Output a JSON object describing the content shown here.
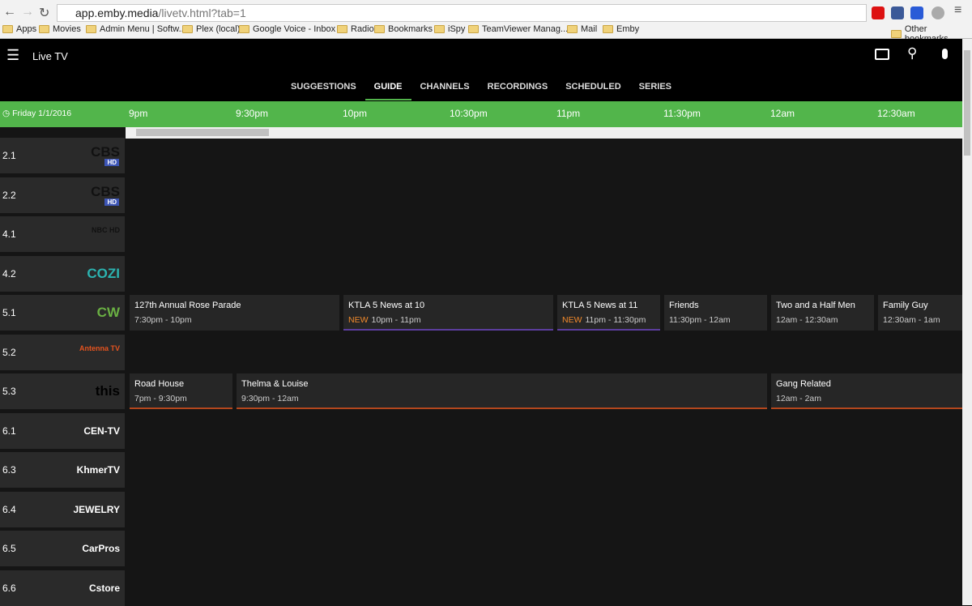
{
  "browser": {
    "url_host": "app.emby.media",
    "url_path": "/livetv.html?tab=1",
    "bookmarks": [
      "Apps",
      "Movies",
      "Admin Menu | Softw...",
      "Plex (local)",
      "Google Voice - Inbox",
      "Radio",
      "Bookmarks",
      "iSpy",
      "TeamViewer Manag...",
      "Mail",
      "Emby"
    ],
    "other_bookmarks": "Other bookmarks"
  },
  "app": {
    "title": "Live TV",
    "tabs": [
      "SUGGESTIONS",
      "GUIDE",
      "CHANNELS",
      "RECORDINGS",
      "SCHEDULED",
      "SERIES"
    ],
    "active_tab": "GUIDE",
    "accent": "#52b54b"
  },
  "guide": {
    "date": "Friday 1/1/2016",
    "times": [
      "9pm",
      "9:30pm",
      "10pm",
      "10:30pm",
      "11pm",
      "11:30pm",
      "12am",
      "12:30am"
    ],
    "channels": [
      {
        "number": "2.1",
        "logo": "CBS",
        "logo_sub": "HD"
      },
      {
        "number": "2.2",
        "logo": "CBS",
        "logo_sub": "HD"
      },
      {
        "number": "4.1",
        "logo": "NBC HD"
      },
      {
        "number": "4.2",
        "logo": "COZI"
      },
      {
        "number": "5.1",
        "logo": "CW"
      },
      {
        "number": "5.2",
        "logo": "Antenna TV"
      },
      {
        "number": "5.3",
        "logo": "this"
      },
      {
        "number": "6.1",
        "name": "CEN-TV"
      },
      {
        "number": "6.3",
        "name": "KhmerTV"
      },
      {
        "number": "6.4",
        "name": "JEWELRY"
      },
      {
        "number": "6.5",
        "name": "CarPros"
      },
      {
        "number": "6.6",
        "name": "Cstore"
      }
    ],
    "programs": [
      {
        "row": 4,
        "title": "127th Annual Rose Parade",
        "time": "7:30pm - 10pm",
        "start": -90,
        "end": 60
      },
      {
        "row": 4,
        "title": "KTLA 5 News at 10",
        "time": "10pm - 11pm",
        "new": "NEW",
        "start": 60,
        "end": 120,
        "border": "#5c3d9e"
      },
      {
        "row": 4,
        "title": "KTLA 5 News at 11",
        "time": "11pm - 11:30pm",
        "new": "NEW",
        "start": 120,
        "end": 150,
        "border": "#5c3d9e"
      },
      {
        "row": 4,
        "title": "Friends",
        "time": "11:30pm - 12am",
        "start": 150,
        "end": 180
      },
      {
        "row": 4,
        "title": "Two and a Half Men",
        "time": "12am - 12:30am",
        "start": 180,
        "end": 210
      },
      {
        "row": 4,
        "title": "Family Guy",
        "time": "12:30am - 1am",
        "start": 210,
        "end": 240
      },
      {
        "row": 6,
        "title": "Road House",
        "time": "7pm - 9:30pm",
        "start": -120,
        "end": 30,
        "border": "#b4471d"
      },
      {
        "row": 6,
        "title": "Thelma & Louise",
        "time": "9:30pm - 12am",
        "start": 30,
        "end": 180,
        "border": "#b4471d"
      },
      {
        "row": 6,
        "title": "Gang Related",
        "time": "12am - 2am",
        "start": 180,
        "end": 300,
        "border": "#b4471d"
      }
    ]
  }
}
